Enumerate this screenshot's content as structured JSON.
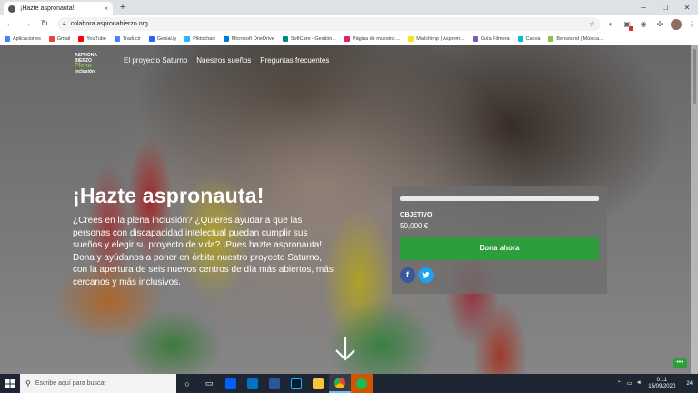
{
  "browser": {
    "tab_title": "¡Hazte aspronauta!",
    "tab_close": "×",
    "new_tab": "+",
    "url": "colabora.aspronabierzo.org",
    "bookmarks": [
      {
        "label": "Aplicaciones",
        "color": "#4285f4"
      },
      {
        "label": "Gmail",
        "color": "#ea4335"
      },
      {
        "label": "YouTube",
        "color": "#ff0000"
      },
      {
        "label": "Traducir",
        "color": "#4285f4"
      },
      {
        "label": "Genial.ly",
        "color": "#2962ff"
      },
      {
        "label": "Piktochart",
        "color": "#29b6f6"
      },
      {
        "label": "Microsoft OneDrive",
        "color": "#0078d4"
      },
      {
        "label": "SoftCare - Gestión...",
        "color": "#00897b"
      },
      {
        "label": "Página de muestra:...",
        "color": "#e91e63"
      },
      {
        "label": "Mailchimp | Asprom...",
        "color": "#ffe01b"
      },
      {
        "label": "Guía Filmora",
        "color": "#7e57c2"
      },
      {
        "label": "Canva",
        "color": "#00c4cc"
      },
      {
        "label": "Bensound | Música...",
        "color": "#8bc34a"
      }
    ]
  },
  "site": {
    "logo_top": "ASPRONA",
    "logo_mid": "BIERZO",
    "logo_brand": "Plena",
    "logo_sub": "inclusión",
    "nav": [
      "El proyecto Saturno",
      "Nuestros sueños",
      "Preguntas frecuentes"
    ],
    "hero_title": "¡Hazte aspronauta!",
    "hero_text": "¿Crees en la plena inclusión? ¿Quieres ayudar a que las personas con discapacidad intelectual puedan cumplir sus sueños y elegir su proyecto de vida? ¡Pues hazte aspronauta! Dona y ayúdanos a poner en órbita nuestro proyecto Saturno, con la apertura de seis nuevos centros de día más abiertos, más cercanos y más inclusivos.",
    "goal_label": "OBJETIVO",
    "goal_amount": "50,000 €",
    "progress_fraction": 0.0,
    "donate_button": "Dona ahora",
    "fb_icon": "f",
    "chat_icon": "•••"
  },
  "taskbar": {
    "search_placeholder": "Escribe aquí para buscar",
    "time": "0:11",
    "date": "15/09/2020",
    "notif_count": "24"
  }
}
